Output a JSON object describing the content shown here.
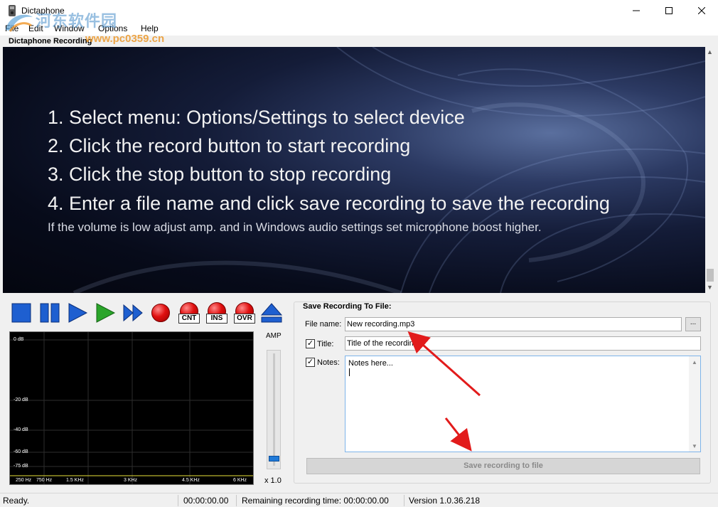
{
  "window": {
    "title": "Dictaphone",
    "minimize_icon": "minimize-icon",
    "maximize_icon": "maximize-icon",
    "close_icon": "close-icon"
  },
  "menu": [
    "File",
    "Edit",
    "Window",
    "Options",
    "Help"
  ],
  "section_label": "Dictaphone Recording",
  "banner": {
    "lines": [
      "1. Select menu: Options/Settings to select device",
      "2. Click the record button to start recording",
      "3. Click the stop button to stop recording",
      "4. Enter a file name and click save recording to save the recording"
    ],
    "note": "If the volume is low adjust amp. and in Windows audio settings set microphone boost higher."
  },
  "transport": {
    "buttons": [
      "stop",
      "pause",
      "play",
      "play-green",
      "fast-forward",
      "record",
      "continue",
      "insert",
      "overwrite",
      "eject"
    ],
    "cnt_label": "CNT",
    "ins_label": "INS",
    "ovr_label": "OVR"
  },
  "spectrum": {
    "db_labels": [
      "0 dB",
      "-20 dB",
      "-40 dB",
      "-60 dB",
      "-75 dB"
    ],
    "hz_labels": [
      "250 Hz",
      "750 Hz",
      "1.5 KHz",
      "3 KHz",
      "4.5 KHz",
      "6 KHz"
    ]
  },
  "amp": {
    "label": "AMP",
    "value": "x 1.0",
    "level": 0.05
  },
  "save": {
    "group_title": "Save Recording To File:",
    "file_name_label": "File name:",
    "file_name_value": "New recording.mp3",
    "browse_label": "...",
    "title_label": "Title:",
    "title_checked": true,
    "title_value": "Title of the recording",
    "notes_label": "Notes:",
    "notes_checked": true,
    "notes_value": "Notes here...",
    "save_button": "Save recording to file"
  },
  "status": {
    "state": "Ready.",
    "elapsed": "00:00:00.00",
    "remaining": "Remaining recording time: 00:00:00.00",
    "version": "Version 1.0.36.218"
  },
  "watermark": {
    "text": "河东软件园",
    "url": "www.pc0359.cn"
  },
  "colors": {
    "accent_blue": "#1f7ad8",
    "record_red": "#e01010",
    "play_green": "#2aa52a",
    "arrow_red": "#e21b1b"
  }
}
